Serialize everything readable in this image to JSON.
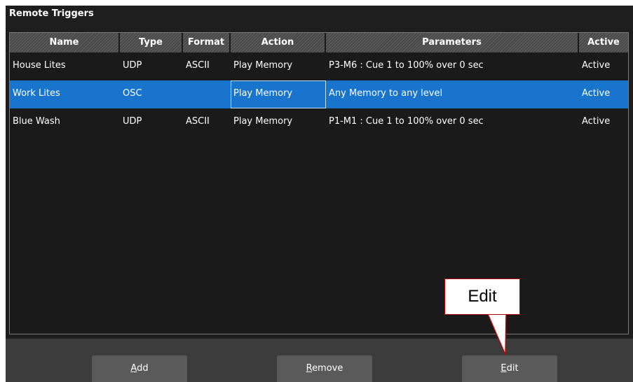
{
  "panel": {
    "title": "Remote Triggers"
  },
  "table": {
    "columns": [
      "Name",
      "Type",
      "Format",
      "Action",
      "Parameters",
      "Active"
    ],
    "rows": [
      {
        "name": "House Lites",
        "type": "UDP",
        "format": "ASCII",
        "action": "Play Memory",
        "parameters": "P3-M6 : Cue 1 to 100% over 0 sec",
        "active": "Active",
        "selected": false
      },
      {
        "name": "Work Lites",
        "type": "OSC",
        "format": "",
        "action": "Play Memory",
        "parameters": "Any Memory to any level",
        "active": "Active",
        "selected": true
      },
      {
        "name": "Blue Wash",
        "type": "UDP",
        "format": "ASCII",
        "action": "Play Memory",
        "parameters": "P1-M1 : Cue 1 to 100% over 0 sec",
        "active": "Active",
        "selected": false
      }
    ]
  },
  "buttons": {
    "add": {
      "accel": "A",
      "rest": "dd"
    },
    "remove": {
      "accel": "R",
      "rest": "emove"
    },
    "edit": {
      "accel": "E",
      "rest": "dit"
    }
  },
  "callout": {
    "text": "Edit"
  },
  "colors": {
    "selection": "#1874cd",
    "callout_border": "#c00000",
    "background": "#1e1e1e"
  }
}
